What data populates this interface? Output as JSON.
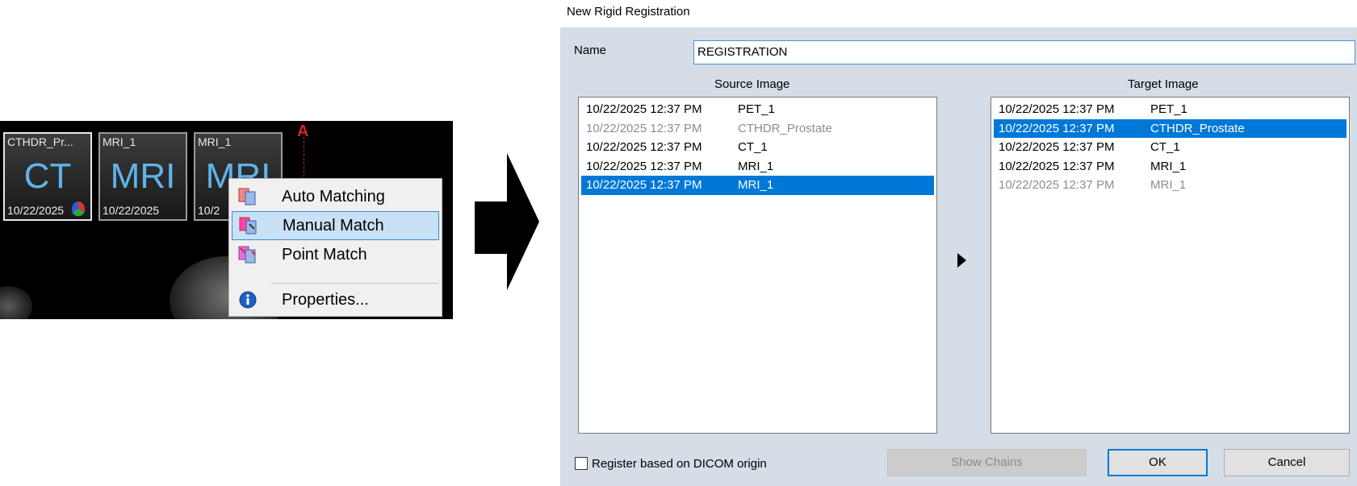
{
  "viewer": {
    "orientation_marker": "A",
    "thumbnails": [
      {
        "name": "CTHDR_Pr...",
        "modality": "CT",
        "date": "10/22/2025"
      },
      {
        "name": "MRI_1",
        "modality": "MRI",
        "date": "10/22/2025"
      },
      {
        "name": "MRI_1",
        "modality": "MRI",
        "date": "10/2"
      }
    ],
    "context_menu": {
      "items": [
        "Auto Matching",
        "Manual Match",
        "Point Match",
        "Properties..."
      ],
      "highlighted": "Manual Match"
    }
  },
  "dialog": {
    "title": "New Rigid Registration",
    "name_label": "Name",
    "name_value": "REGISTRATION",
    "source_header": "Source Image",
    "target_header": "Target Image",
    "source_list": [
      {
        "date": "10/22/2025 12:37 PM",
        "name": "PET_1",
        "state": "normal"
      },
      {
        "date": "10/22/2025 12:37 PM",
        "name": "CTHDR_Prostate",
        "state": "disabled"
      },
      {
        "date": "10/22/2025 12:37 PM",
        "name": "CT_1",
        "state": "normal"
      },
      {
        "date": "10/22/2025 12:37 PM",
        "name": "MRI_1",
        "state": "normal"
      },
      {
        "date": "10/22/2025 12:37 PM",
        "name": "MRI_1",
        "state": "selected"
      }
    ],
    "target_list": [
      {
        "date": "10/22/2025 12:37 PM",
        "name": "PET_1",
        "state": "normal"
      },
      {
        "date": "10/22/2025 12:37 PM",
        "name": "CTHDR_Prostate",
        "state": "selected"
      },
      {
        "date": "10/22/2025 12:37 PM",
        "name": "CT_1",
        "state": "normal"
      },
      {
        "date": "10/22/2025 12:37 PM",
        "name": "MRI_1",
        "state": "normal"
      },
      {
        "date": "10/22/2025 12:37 PM",
        "name": "MRI_1",
        "state": "disabled"
      }
    ],
    "checkbox_label": "Register based on DICOM origin",
    "checkbox_checked": false,
    "buttons": {
      "show_chains": "Show Chains",
      "ok": "OK",
      "cancel": "Cancel"
    }
  },
  "colors": {
    "selection": "#0078d7",
    "dialog_bg": "#d5dde6",
    "menu_highlight": "#c9e1f7",
    "ct_mri_text": "#5fb3ea"
  }
}
